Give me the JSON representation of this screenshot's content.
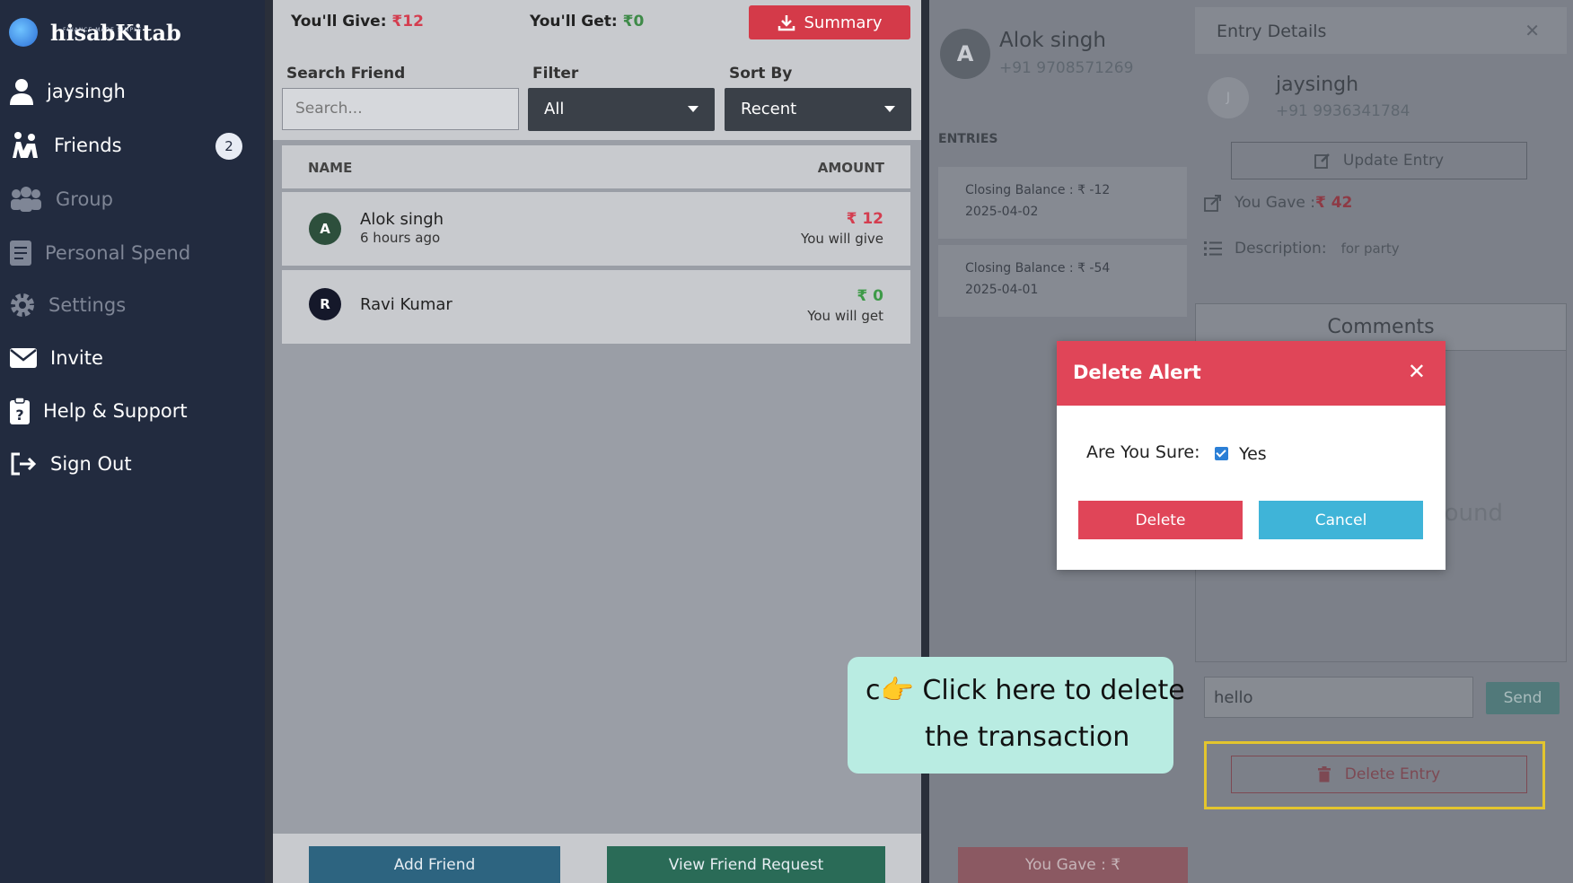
{
  "app": {
    "name": "hisabKitab",
    "tagline": "FINANCE MADE SIMPLE"
  },
  "sidebar": {
    "items": [
      {
        "label": "jaysingh",
        "icon": "user-icon"
      },
      {
        "label": "Friends",
        "icon": "friends-icon",
        "badge": "2"
      },
      {
        "label": "Group",
        "icon": "group-icon"
      },
      {
        "label": "Personal Spend",
        "icon": "notebook-icon"
      },
      {
        "label": "Settings",
        "icon": "gear-icon"
      },
      {
        "label": "Invite",
        "icon": "envelope-icon"
      },
      {
        "label": "Help & Support",
        "icon": "help-icon"
      },
      {
        "label": "Sign Out",
        "icon": "signout-icon"
      }
    ]
  },
  "summary_bar": {
    "give_label": "You'll Give:",
    "give_value": "₹12",
    "get_label": "You'll Get:",
    "get_value": "₹0",
    "summary_button": "Summary"
  },
  "filters": {
    "search_label": "Search Friend",
    "search_placeholder": "Search...",
    "filter_label": "Filter",
    "filter_value": "All",
    "sort_label": "Sort By",
    "sort_value": "Recent"
  },
  "table": {
    "headers": {
      "name": "NAME",
      "amount": "AMOUNT"
    },
    "rows": [
      {
        "initial": "A",
        "name": "Alok singh",
        "time": "6 hours ago",
        "amount": "₹ 12",
        "note": "You will give"
      },
      {
        "initial": "R",
        "name": "Ravi Kumar",
        "time": "",
        "amount": "₹ 0",
        "note": "You will get"
      }
    ]
  },
  "bottom": {
    "add_friend": "Add Friend",
    "view_request": "View Friend Request"
  },
  "contact": {
    "initial": "A",
    "name": "Alok singh",
    "phone": "+91 9708571269"
  },
  "entries": {
    "label": "ENTRIES",
    "items": [
      {
        "balance": "Closing Balance : ₹ -12",
        "date": "2025-04-02"
      },
      {
        "balance": "Closing Balance : ₹ -54",
        "date": "2025-04-01"
      }
    ],
    "bottom_you_gave": "You Gave : ₹"
  },
  "details": {
    "title": "Entry Details",
    "initial": "J",
    "name": "jaysingh",
    "phone": "+91 9936341784",
    "update_button": "Update Entry",
    "you_gave_label": "You Gave :",
    "you_gave_value": "₹ 42",
    "description_label": "Description:",
    "description_value": "for party",
    "comments_title": "Comments",
    "comments_empty": "ound",
    "comment_input": "hello",
    "send_button": "Send",
    "delete_button": "Delete Entry"
  },
  "modal": {
    "title": "Delete Alert",
    "question": "Are You Sure:",
    "yes_label": "Yes",
    "delete_button": "Delete",
    "cancel_button": "Cancel"
  },
  "tooltip": {
    "line1": "c👉 Click here to delete",
    "line2": "the transaction"
  },
  "colors": {
    "sidebar": "#222b3f",
    "danger": "#e04558",
    "info": "#3fb4d8",
    "highlight": "#e3c52e"
  }
}
